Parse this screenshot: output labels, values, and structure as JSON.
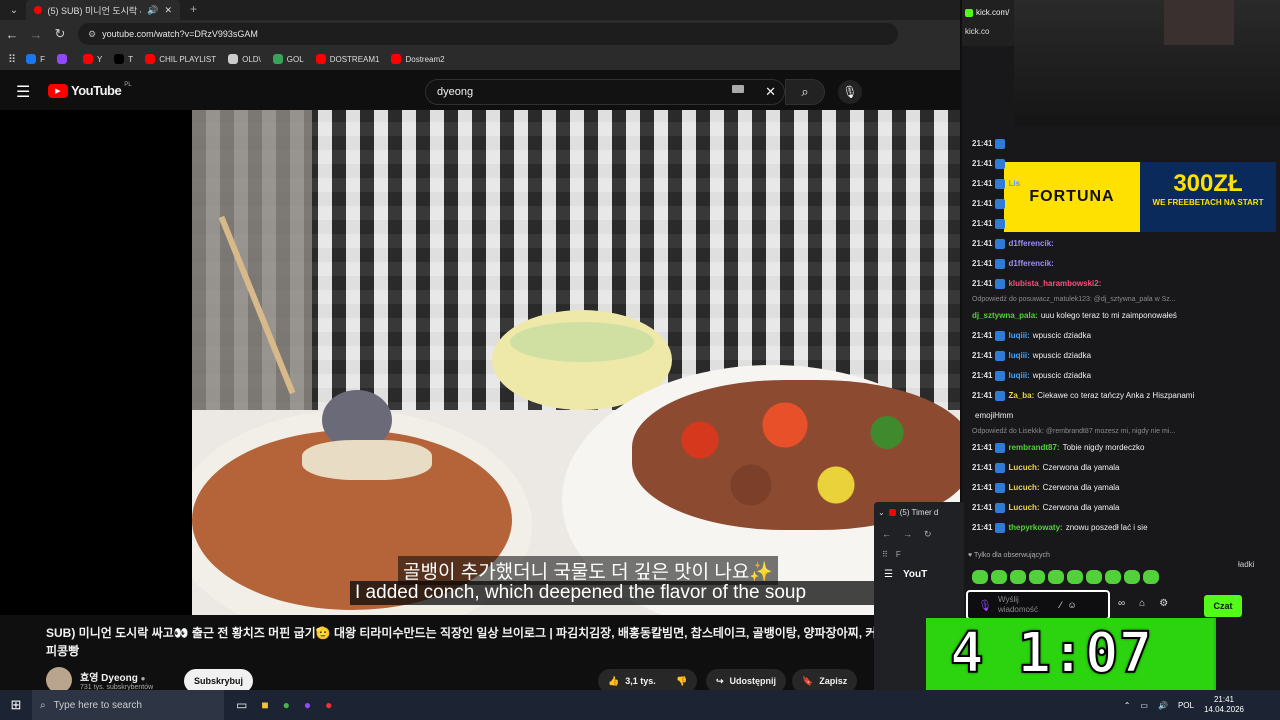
{
  "browser": {
    "tab_title": "(5) SUB) 미니언 도시락 싸",
    "url": "youtube.com/watch?v=DRzV993sGAM",
    "bookmarks": [
      {
        "label": "F",
        "color": "#1877f2"
      },
      {
        "label": "",
        "color": "#9146ff"
      },
      {
        "label": "Y",
        "color": "#ff0000"
      },
      {
        "label": "T",
        "color": "#000000"
      },
      {
        "label": "CHIL PLAYLIST",
        "color": "#ff0000"
      },
      {
        "label": "OLD\\",
        "color": "#cccccc"
      },
      {
        "label": "GOL",
        "color": "#3aa35b"
      },
      {
        "label": "DOSTREAM1",
        "color": "#ff0000"
      },
      {
        "label": "Dostream2",
        "color": "#ff0000"
      }
    ]
  },
  "youtube": {
    "logo_text": "YouTube",
    "logo_region": "PL",
    "search_value": "dyeong",
    "subtitle_korean": "골뱅이 추가했더니 국물도 더 깊은 맛이 나요✨",
    "subtitle_english": "I added conch, which deepened the flavor of the soup",
    "title": "SUB) 미니언 도시락 싸고👀 출근 전 황치즈 머핀 굽기🫡 대왕 티라미수만드는 직장인 일상 브이로그 | 파김치김장, 배홍동칼빔면, 찹스테이크, 골뱅이탕, 양파장아찌, 커피콩빵",
    "channel_name": "효영 Dyeong",
    "subscribers": "731 tys. subskrybentów",
    "subscribe_label": "Subskrybuj",
    "likes": "3,1 tys.",
    "share_label": "Udostępnij",
    "save_label": "Zapisz"
  },
  "stream": {
    "tab_label": "kick.com/",
    "tab_label2": "kick.co",
    "ad_brand": "FORTUNA",
    "ad_amount": "300ZŁ",
    "ad_tagline": "WE FREEBETACH NA START",
    "reply1": "Odpowiedź do posuwacz_matulek123: @dj_sztywna_pala w Sz...",
    "reply2": "Odpowiedź do Lisekkk: @rembrandt87 mozesz mi, nigdy nie mi...",
    "chat": [
      {
        "time": "21:41",
        "user": "",
        "text": "",
        "userColor": "#efeff1"
      },
      {
        "time": "21:41",
        "user": "",
        "text": "",
        "userColor": "#efeff1"
      },
      {
        "time": "21:41",
        "user": "Lis",
        "text": "",
        "userColor": "#3ea6ff"
      },
      {
        "time": "21:41",
        "user": "",
        "text": "",
        "userColor": "#efeff1"
      },
      {
        "time": "21:41",
        "user": "",
        "text": "",
        "userColor": "#efeff1"
      },
      {
        "time": "21:41",
        "user": "d1fferencik:",
        "text": "",
        "userColor": "#9b8cff"
      },
      {
        "time": "21:41",
        "user": "d1fferencik:",
        "text": "",
        "userColor": "#9b8cff"
      },
      {
        "time": "21:41",
        "user": "klubista_harambowski2:",
        "text": "",
        "userColor": "#ff4d7d"
      },
      {
        "time": "",
        "user": "dj_sztywna_pala:",
        "text": "uuu kolego teraz to mi zaimponowałeś",
        "userColor": "#53d13a"
      },
      {
        "time": "21:41",
        "user": "luqiii:",
        "text": "wpuscic dziadka",
        "userColor": "#3ea6ff"
      },
      {
        "time": "21:41",
        "user": "luqiii:",
        "text": "wpuscic dziadka",
        "userColor": "#3ea6ff"
      },
      {
        "time": "21:41",
        "user": "luqiii:",
        "text": "wpuscic dziadka",
        "userColor": "#3ea6ff"
      },
      {
        "time": "21:41",
        "user": "Za_ba:",
        "text": "Ciekawe co teraz tańczy Anka z Hiszpanami",
        "userColor": "#e8d44d"
      },
      {
        "time": "",
        "user": "",
        "text": "emojiHmm",
        "userColor": "#efeff1"
      },
      {
        "time": "21:41",
        "user": "rembrandt87:",
        "text": "Tobie nigdy mordeczko",
        "userColor": "#53d13a"
      },
      {
        "time": "21:41",
        "user": "Lucuch:",
        "text": "Czerwona dla yamala",
        "userColor": "#e8d44d"
      },
      {
        "time": "21:41",
        "user": "Lucuch:",
        "text": "Czerwona dla yamala",
        "userColor": "#e8d44d"
      },
      {
        "time": "21:41",
        "user": "Lucuch:",
        "text": "Czerwona dla yamala",
        "userColor": "#e8d44d"
      },
      {
        "time": "21:41",
        "user": "thepyrkowaty:",
        "text": "znowu poszedł lać i sie",
        "userColor": "#53d13a"
      }
    ],
    "followers_only": "Tylko dla obserwujących",
    "chat_placeholder": "Wyślij wiadomość",
    "chat_button": "Czat",
    "mini_tab": "(5) Timer d",
    "mini_yt": "YouT",
    "mini_side": "ładki",
    "timer": "4 1:07"
  },
  "taskbar": {
    "search_placeholder": "Type here to search",
    "lang": "POL",
    "time": "21:41",
    "date": "14.04.2026"
  }
}
